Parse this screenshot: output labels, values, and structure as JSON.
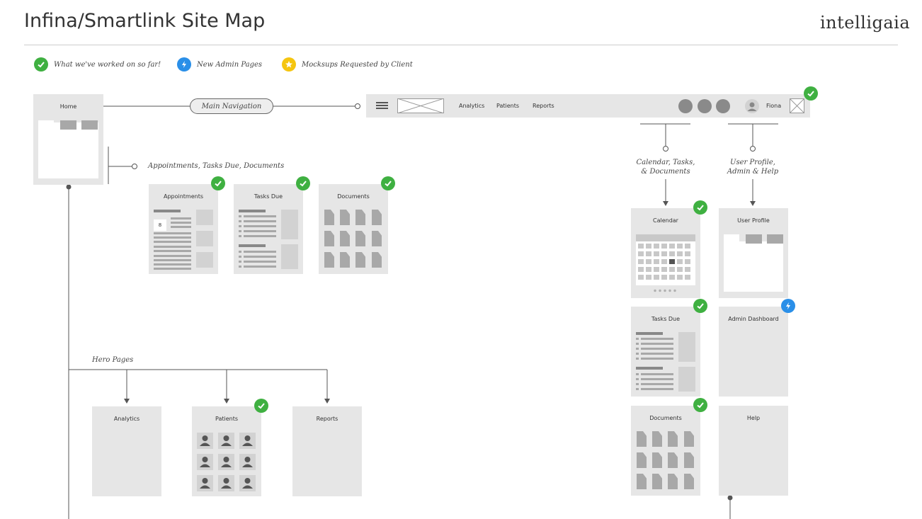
{
  "title": "Infina/Smartlink Site Map",
  "brand": "intelligaia",
  "legend": [
    {
      "label": "What we've worked on so far!",
      "icon": "check-icon",
      "color": "#3fb041"
    },
    {
      "label": "New Admin Pages",
      "icon": "bolt-icon",
      "color": "#2a8fe8"
    },
    {
      "label": "Mocksups Requested by Client",
      "icon": "star-icon",
      "color": "#f5c50f"
    }
  ],
  "home": {
    "title": "Home"
  },
  "main_nav_label": "Main Navigation",
  "appointments_branch_label": "Appointments, Tasks Due, Documents",
  "navbar": {
    "links": [
      "Analytics",
      "Patients",
      "Reports"
    ],
    "user": "Fiona"
  },
  "cards": {
    "appointments": {
      "title": "Appointments",
      "date": "8"
    },
    "tasks_due": {
      "title": "Tasks Due"
    },
    "documents": {
      "title": "Documents"
    },
    "analytics": {
      "title": "Analytics"
    },
    "patients": {
      "title": "Patients"
    },
    "reports": {
      "title": "Reports"
    },
    "calendar": {
      "title": "Calendar"
    },
    "tasks_due_right": {
      "title": "Tasks Due"
    },
    "documents_right": {
      "title": "Documents"
    },
    "user_profile": {
      "title": "User Profile"
    },
    "admin_dashboard": {
      "title": "Admin Dashboard"
    },
    "help": {
      "title": "Help"
    }
  },
  "hero_label": "Hero Pages",
  "branch_labels": {
    "calendar_line1": "Calendar, Tasks,",
    "calendar_line2": "& Documents",
    "profile_line1": "User Profile,",
    "profile_line2": "Admin & Help"
  }
}
